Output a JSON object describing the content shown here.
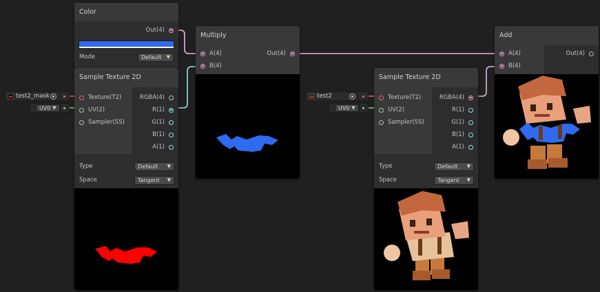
{
  "color_node": {
    "title": "Color",
    "out_label": "Out(4)",
    "swatch_color": "#2f6bf0",
    "mode_label": "Mode",
    "mode_value": "Default"
  },
  "sample1": {
    "title": "Sample Texture 2D",
    "inputs": [
      "Texture(T2)",
      "UV(2)",
      "Sampler(SS)"
    ],
    "outputs": [
      "RGBA(4)",
      "R(1)",
      "G(1)",
      "B(1)",
      "A(1)"
    ],
    "type_label": "Type",
    "type_value": "Default",
    "space_label": "Space",
    "space_value": "Tangent",
    "texture_chip": "test2_mask",
    "uv_chip": "UV0"
  },
  "multiply": {
    "title": "Multiply",
    "inputs": [
      "A(4)",
      "B(4)"
    ],
    "output": "Out(4)"
  },
  "sample2": {
    "title": "Sample Texture 2D",
    "inputs": [
      "Texture(T2)",
      "UV(2)",
      "Sampler(SS)"
    ],
    "outputs": [
      "RGBA(4)",
      "R(1)",
      "G(1)",
      "B(1)",
      "A(1)"
    ],
    "type_label": "Type",
    "type_value": "Default",
    "space_label": "Space",
    "space_value": "Tangent",
    "texture_chip": "test2",
    "uv_chip": "UV0"
  },
  "add": {
    "title": "Add",
    "inputs": [
      "A(4)",
      "B(4)"
    ],
    "output": "Out(4)"
  },
  "colors": {
    "canvas_bg": "#202020",
    "wire_vector4": "#e9b3de",
    "wire_float": "#8de2e0",
    "mask_red": "#ff0000",
    "shirt_blue": "#2f6bf0"
  },
  "icons": [
    "dropdown-arrow-icon",
    "texture-icon",
    "object-picker-icon",
    "port-icon"
  ]
}
